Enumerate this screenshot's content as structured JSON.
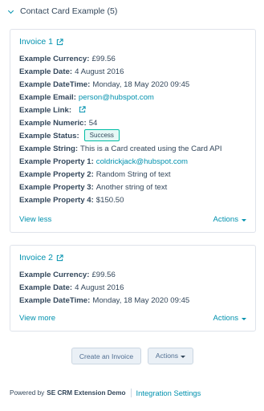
{
  "section": {
    "title": "Contact Card Example (5)"
  },
  "colors": {
    "link": "#0091ae",
    "text": "#33475b",
    "border": "#dfe3eb",
    "success_bg": "#e5f8f6",
    "success_border": "#00bda5"
  },
  "cards": [
    {
      "title": "Invoice 1",
      "properties": [
        {
          "label": "Example Currency:",
          "value": "£99.56"
        },
        {
          "label": "Example Date:",
          "value": "4 August 2016"
        },
        {
          "label": "Example DateTime:",
          "value": "Monday, 18 May 2020 09:45"
        },
        {
          "label": "Example Email:",
          "value": "person@hubspot.com"
        },
        {
          "label": "Example Link:",
          "value": ""
        },
        {
          "label": "Example Numeric:",
          "value": "54"
        },
        {
          "label": "Example Status:",
          "value": "Success"
        },
        {
          "label": "Example String:",
          "value": "This is a Card created using the Card API"
        },
        {
          "label": "Example Property 1:",
          "value": "coldrickjack@hubspot.com"
        },
        {
          "label": "Example Property 2:",
          "value": "Random String of text"
        },
        {
          "label": "Example Property 3:",
          "value": "Another string of text"
        },
        {
          "label": "Example Property 4:",
          "value": "$150.50"
        }
      ],
      "footer_left": "View less",
      "footer_right": "Actions"
    },
    {
      "title": "Invoice 2",
      "properties": [
        {
          "label": "Example Currency:",
          "value": "£99.56"
        },
        {
          "label": "Example Date:",
          "value": "4 August 2016"
        },
        {
          "label": "Example DateTime:",
          "value": "Monday, 18 May 2020 09:45"
        }
      ],
      "footer_left": "View more",
      "footer_right": "Actions"
    }
  ],
  "buttons": {
    "create": "Create an Invoice",
    "actions": "Actions"
  },
  "footer": {
    "powered_by": "Powered by",
    "app_name": "SE CRM Extension Demo",
    "settings": "Integration Settings"
  },
  "icons": {
    "section_toggle": "chevron-down-icon",
    "external": "external-link-icon",
    "dropdown": "caret-down-icon"
  }
}
